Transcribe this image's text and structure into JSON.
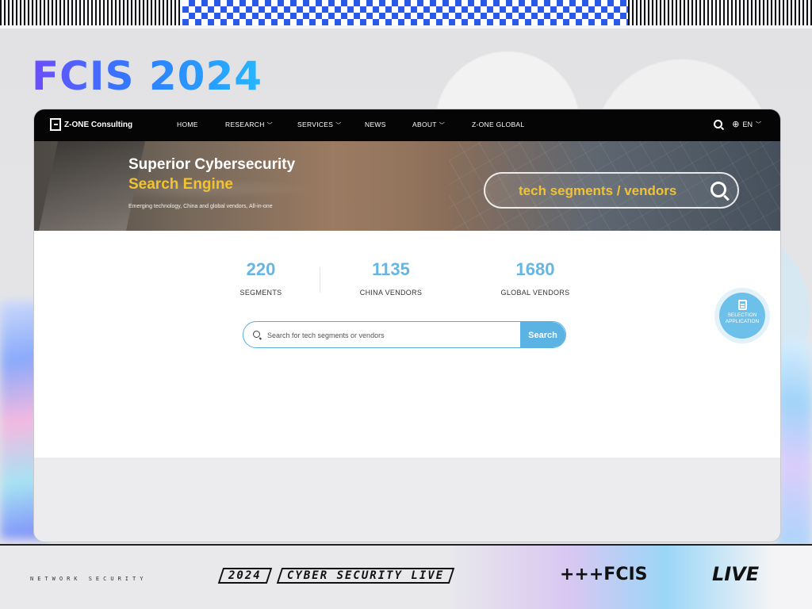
{
  "slide": {
    "logo_text": "FCIS 2024",
    "bottom": {
      "tiny_text": "NETWORK SECURITY",
      "year": "2024",
      "tagline": "CYBER SECURITY LIVE",
      "fcis_mark": "+++FCIS",
      "live_mark": "LIVE"
    }
  },
  "site": {
    "brand": "Z-ONE Consulting",
    "nav": [
      {
        "label": "HOME",
        "has_dropdown": false
      },
      {
        "label": "RESEARCH",
        "has_dropdown": true
      },
      {
        "label": "SERVICES",
        "has_dropdown": true
      },
      {
        "label": "NEWS",
        "has_dropdown": false
      },
      {
        "label": "ABOUT",
        "has_dropdown": true
      },
      {
        "label": "Z-ONE GLOBAL",
        "has_dropdown": false
      }
    ],
    "language": "EN",
    "icons": {
      "search": "search-icon",
      "language": "globe-icon",
      "dropdown": "chevron-down-icon"
    }
  },
  "hero": {
    "title_line1": "Superior Cybersecurity",
    "title_line2": "Search Engine",
    "subtitle": "Emerging technology, China and global vendors, All-in-one",
    "search_text": "tech segments / vendors",
    "accent_color": "#f1c232"
  },
  "stats": [
    {
      "value": "220",
      "label": "SEGMENTS"
    },
    {
      "value": "1135",
      "label": "CHINA VENDORS"
    },
    {
      "value": "1680",
      "label": "GLOBAL VENDORS"
    }
  ],
  "search": {
    "placeholder": "Search for tech segments or vendors",
    "button_label": "Search",
    "accent_color": "#5bb3e4"
  },
  "floating": {
    "line1": "SELECTION",
    "line2": "APPLICATION",
    "icon": "edit-document-icon"
  }
}
